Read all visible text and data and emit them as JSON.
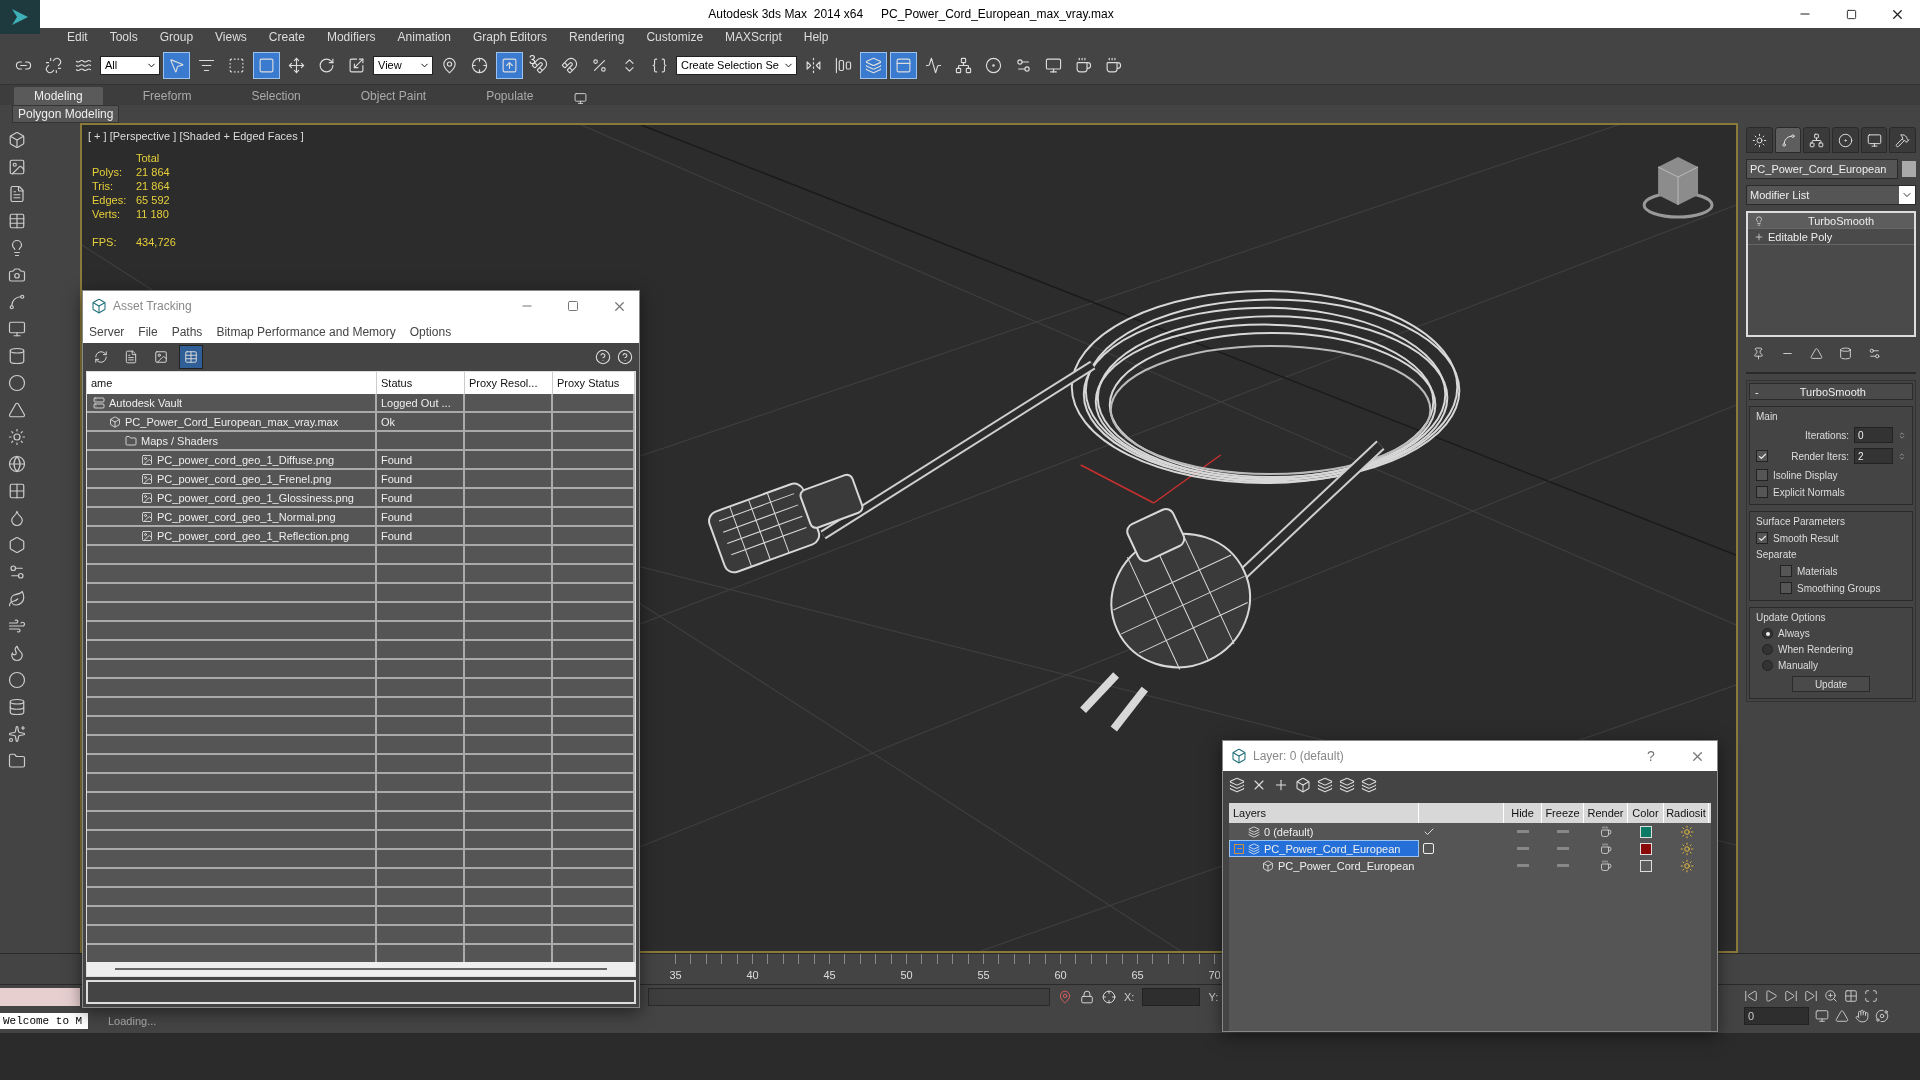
{
  "app_name": "Autodesk 3ds Max  2014 x64",
  "file_name": "PC_Power_Cord_European_max_vray.max",
  "menu": [
    "Edit",
    "Tools",
    "Group",
    "Views",
    "Create",
    "Modifiers",
    "Animation",
    "Graph Editors",
    "Rendering",
    "Customize",
    "MAXScript",
    "Help"
  ],
  "main_toolbar": [
    {
      "kind": "icon",
      "on": false
    },
    {
      "kind": "icon",
      "on": false
    },
    {
      "kind": "icon",
      "on": false
    },
    {
      "kind": "dropdown",
      "value": "All"
    },
    {
      "kind": "icon",
      "on": true
    },
    {
      "kind": "icon",
      "on": false
    },
    {
      "kind": "icon",
      "on": false
    },
    {
      "kind": "icon",
      "on": true
    },
    {
      "kind": "icon",
      "on": false
    },
    {
      "kind": "icon",
      "on": false
    },
    {
      "kind": "icon",
      "on": false
    },
    {
      "kind": "dropdown",
      "value": "View"
    },
    {
      "kind": "icon",
      "on": false
    },
    {
      "kind": "icon",
      "on": false
    },
    {
      "kind": "icon",
      "on": true
    },
    {
      "kind": "icon",
      "on": false,
      "label": "3"
    },
    {
      "kind": "icon",
      "on": false
    },
    {
      "kind": "icon",
      "on": false
    },
    {
      "kind": "icon",
      "on": false
    },
    {
      "kind": "icon",
      "on": false
    },
    {
      "kind": "dropdown",
      "value": "Create Selection Se"
    },
    {
      "kind": "icon",
      "on": false
    },
    {
      "kind": "icon",
      "on": false
    },
    {
      "kind": "icon",
      "on": true
    },
    {
      "kind": "icon",
      "on": true
    },
    {
      "kind": "icon",
      "on": false
    },
    {
      "kind": "icon",
      "on": false
    },
    {
      "kind": "icon",
      "on": false
    },
    {
      "kind": "icon",
      "on": false
    },
    {
      "kind": "icon",
      "on": false
    },
    {
      "kind": "icon",
      "on": false
    },
    {
      "kind": "icon",
      "on": false
    }
  ],
  "ribbon_tabs": [
    {
      "label": "Modeling",
      "selected": true
    },
    {
      "label": "Freeform",
      "selected": false
    },
    {
      "label": "Selection",
      "selected": false
    },
    {
      "label": "Object Paint",
      "selected": false
    },
    {
      "label": "Populate",
      "selected": false
    }
  ],
  "ribbon_panel": "Polygon Modeling",
  "viewport": {
    "label": "[ + ] [Perspective ] [Shaded + Edged Faces ]",
    "stats_header": "Total",
    "stats": [
      {
        "label": "Polys:",
        "value": "21 864"
      },
      {
        "label": "Tris:",
        "value": "21 864"
      },
      {
        "label": "Edges:",
        "value": "65 592"
      },
      {
        "label": "Verts:",
        "value": "11 180"
      }
    ],
    "fps": {
      "label": "FPS:",
      "value": "434,726"
    }
  },
  "asset_tracking": {
    "title": "Asset Tracking",
    "menu": [
      "Server",
      "File",
      "Paths",
      "Bitmap Performance and Memory",
      "Options"
    ],
    "view_buttons": [
      {
        "selected": false
      },
      {
        "selected": false
      },
      {
        "selected": false
      },
      {
        "selected": true
      }
    ],
    "columns": [
      "ame",
      "Status",
      "Proxy Resol...",
      "Proxy Status"
    ],
    "rows": [
      {
        "name": "Autodesk Vault",
        "kind": "vault",
        "status": "Logged Out ...",
        "children": [
          {
            "name": "PC_Power_Cord_European_max_vray.max",
            "kind": "scene",
            "status": "Ok",
            "children": [
              {
                "name": "Maps / Shaders",
                "kind": "folder",
                "children": [
                  {
                    "name": "PC_power_cord_geo_1_Diffuse.png",
                    "kind": "bitmap",
                    "status": "Found"
                  },
                  {
                    "name": "PC_power_cord_geo_1_Frenel.png",
                    "kind": "bitmap",
                    "status": "Found"
                  },
                  {
                    "name": "PC_power_cord_geo_1_Glossiness.png",
                    "kind": "bitmap",
                    "status": "Found"
                  },
                  {
                    "name": "PC_power_cord_geo_1_Normal.png",
                    "kind": "bitmap",
                    "status": "Found"
                  },
                  {
                    "name": "PC_power_cord_geo_1_Reflection.png",
                    "kind": "bitmap",
                    "status": "Found"
                  }
                ]
              }
            ]
          }
        ]
      }
    ]
  },
  "command_panel": {
    "tabs": [
      {
        "selected": false
      },
      {
        "selected": true
      },
      {
        "selected": false
      },
      {
        "selected": false
      },
      {
        "selected": false
      },
      {
        "selected": false
      }
    ],
    "object_name": "PC_Power_Cord_European",
    "modifier_list": "Modifier List",
    "stack": [
      {
        "label": "TurboSmooth",
        "kind": "modifier",
        "selected": true
      },
      {
        "label": "Editable Poly",
        "kind": "base",
        "selected": false
      }
    ],
    "rollout": {
      "collapse": "-",
      "title": "TurboSmooth",
      "main": {
        "title": "Main",
        "fields": [
          {
            "kind": "spinner",
            "label": "Iterations:",
            "value": "0"
          },
          {
            "kind": "check_spinner",
            "label": "Render Iters:",
            "value": "2",
            "checked": true
          },
          {
            "kind": "check",
            "label": "Isoline Display",
            "checked": false
          },
          {
            "kind": "check",
            "label": "Explicit Normals",
            "checked": false
          }
        ]
      },
      "surface": {
        "title": "Surface Parameters",
        "smooth_result": {
          "label": "Smooth Result",
          "checked": true
        },
        "separate": "Separate",
        "options": [
          {
            "label": "Materials",
            "checked": false
          },
          {
            "label": "Smoothing Groups",
            "checked": false
          }
        ]
      },
      "update": {
        "title": "Update Options",
        "options": [
          {
            "label": "Always",
            "selected": true
          },
          {
            "label": "When Rendering",
            "selected": false
          },
          {
            "label": "Manually",
            "selected": false
          }
        ],
        "button": "Update"
      }
    }
  },
  "layer_manager": {
    "title": "Layer: 0 (default)",
    "help": "?",
    "columns": [
      "Layers",
      "Hide",
      "Freeze",
      "Render",
      "Color",
      "Radiosit"
    ],
    "rows": [
      {
        "name": "0 (default)",
        "kind": "layer",
        "current": true,
        "selected": false,
        "color": "#0b7b66"
      },
      {
        "name": "PC_Power_Cord_European",
        "kind": "layer",
        "current": false,
        "selected": true,
        "expanded": true,
        "color": "#8a0a0a",
        "children": [
          {
            "name": "PC_Power_Cord_European",
            "kind": "object",
            "selected": false,
            "color": "#5c5c5c"
          }
        ]
      }
    ]
  },
  "timeline": {
    "ticks": [
      "35",
      "40",
      "45",
      "50",
      "55",
      "60",
      "65",
      "70"
    ]
  },
  "status": {
    "welcome": "Welcome to M",
    "prompt": "Loading...",
    "x_label": "X:",
    "y_label": "Y:",
    "frame": "0"
  }
}
